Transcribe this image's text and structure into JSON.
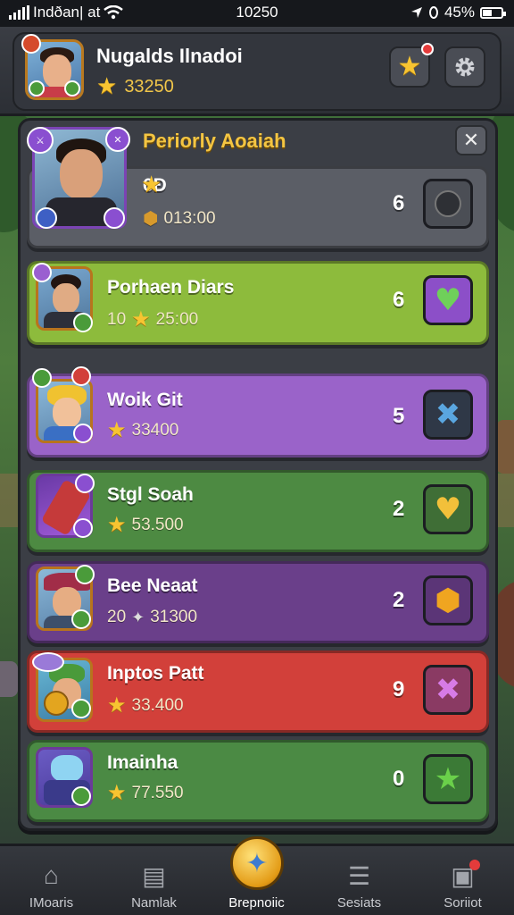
{
  "status_bar": {
    "carrier": "Indðan| at",
    "time": "10250",
    "battery": "45%",
    "battery_level": 0.45
  },
  "header": {
    "player_name": "Nugalds Ilnadoi",
    "score": "33250",
    "icons": {
      "favorites": "star-icon",
      "settings": "gear-icon"
    }
  },
  "panel": {
    "title": "Periorly Aoaiah",
    "close_icon": "close-icon"
  },
  "rows": [
    {
      "name": "6Ð",
      "sub": "013:00",
      "count": "6",
      "color": "#5b5e66",
      "action_icon": "circle-icon",
      "action_color": "#4b4e55"
    },
    {
      "name": "Porhaen Diars",
      "sub_prefix": "10",
      "sub": "25:00",
      "count": "6",
      "color": "#8dbb3c",
      "action_icon": "heart-icon",
      "action_color": "#8c4fc8"
    },
    {
      "name": "Woik Git",
      "sub": "33400",
      "count": "5",
      "color": "#9a63c9",
      "action_icon": "x-icon",
      "action_color": "#2f3847"
    },
    {
      "name": "Stgl Soah",
      "sub": "53.500",
      "count": "2",
      "color": "#4d8a42",
      "action_icon": "heart-icon",
      "action_color": "#3f6e36"
    },
    {
      "name": "Bee Neaat",
      "sub_prefix": "20",
      "sub": "31300",
      "count": "2",
      "color": "#6a3f8a",
      "action_icon": "coin-icon",
      "action_color": "#5b3577"
    },
    {
      "name": "Inptos Patt",
      "sub": "33.400",
      "count": "9",
      "color": "#d2403a",
      "action_icon": "x-icon",
      "action_color": "#8a3a63"
    },
    {
      "name": "Imainha",
      "sub": "77.550",
      "count": "0",
      "color": "#4b8a44",
      "action_icon": "star-icon",
      "action_color": "#3b7a36"
    }
  ],
  "bottom_nav": [
    {
      "label": "IMoaris",
      "icon": "home-icon"
    },
    {
      "label": "Namlak",
      "icon": "cards-icon"
    },
    {
      "label": "Brepnoiic",
      "icon": "sword-icon"
    },
    {
      "label": "Sesiats",
      "icon": "list-icon"
    },
    {
      "label": "Soriiot",
      "icon": "shop-icon"
    }
  ]
}
